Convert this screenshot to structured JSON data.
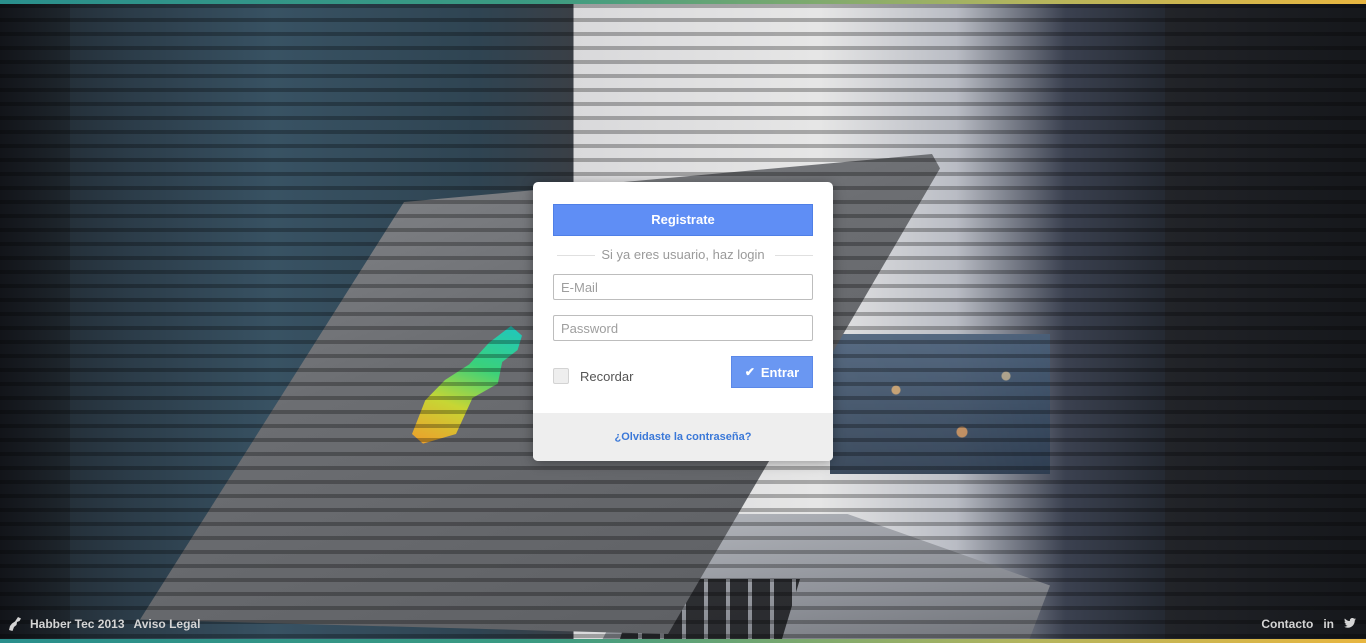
{
  "login": {
    "register_label": "Registrate",
    "divider_text": "Si ya eres usuario, haz login",
    "email_placeholder": "E-Mail",
    "password_placeholder": "Password",
    "remember_label": "Recordar",
    "enter_label": "Entrar",
    "forgot_label": "¿Olvidaste la contraseña?"
  },
  "footer": {
    "brand": "Habber Tec 2013",
    "legal": "Aviso Legal",
    "contact": "Contacto",
    "linkedin_icon": "linkedin-icon",
    "twitter_icon": "twitter-icon"
  },
  "colors": {
    "primary": "#5f8ef5",
    "link": "#3a78d8",
    "accent_bar_start": "#2a8f8c",
    "accent_bar_end": "#e8b640"
  }
}
